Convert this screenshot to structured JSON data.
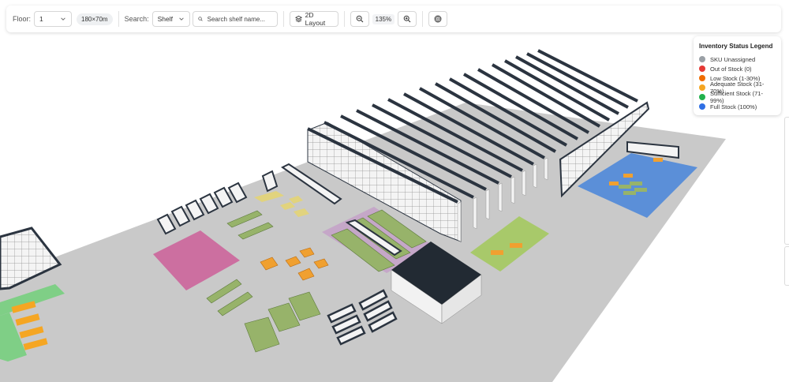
{
  "toolbar": {
    "floor_label": "Floor:",
    "floor_value": "1",
    "floor_size": "180×70m",
    "search_label": "Search:",
    "search_type": "Shelf",
    "search_placeholder": "Search shelf name...",
    "layout_button": "2D Layout",
    "zoom_level": "135%"
  },
  "icons": {
    "chevron": "chevron-down-icon",
    "search": "search-icon",
    "layers": "layers-icon",
    "zoom_out": "zoom-out-icon",
    "zoom_in": "zoom-in-icon",
    "target": "target-icon"
  },
  "legend": {
    "title": "Inventory Status Legend",
    "items": [
      {
        "label": "SKU Unassigned",
        "color": "#9aa0a6"
      },
      {
        "label": "Out of Stock (0)",
        "color": "#e53935"
      },
      {
        "label": "Low Stock (1-30%)",
        "color": "#ef6c00"
      },
      {
        "label": "Adequate Stock (31-70%)",
        "color": "#f5a623"
      },
      {
        "label": "Sufficient Stock (71-99%)",
        "color": "#22b14c"
      },
      {
        "label": "Full Stock (100%)",
        "color": "#2f6fe4"
      }
    ]
  },
  "colors": {
    "floor": "#c9c9c9",
    "shelf_top": "#2b3440",
    "shelf_face": "#f4f4f4",
    "zone_pink": "#cc6fa0",
    "zone_blue": "#5b8fd8",
    "zone_green": "#a8c96a",
    "zone_purple": "#c5a7c8"
  }
}
